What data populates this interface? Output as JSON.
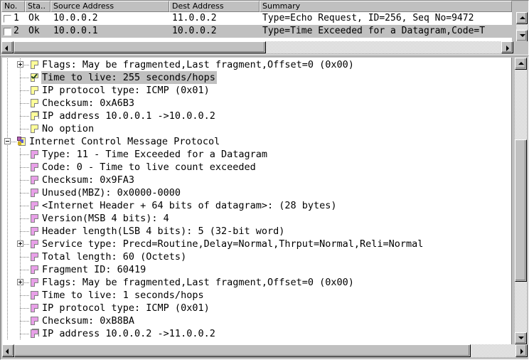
{
  "packet_list": {
    "columns": [
      "No.",
      "Sta..",
      "Source Address",
      "Dest Address",
      "Summary"
    ],
    "rows": [
      {
        "no": "1",
        "status": "Ok",
        "source": "10.0.0.2",
        "dest": "11.0.0.2",
        "summary": "Type=Echo Request, ID=256, Seq No=9472",
        "selected": false,
        "checked": false
      },
      {
        "no": "2",
        "status": "Ok",
        "source": "10.0.0.1",
        "dest": "10.0.0.2",
        "summary": "Type=Time Exceeded for a Datagram,Code=T",
        "selected": true,
        "checked": false
      }
    ]
  },
  "detail_tree": {
    "nodes": [
      {
        "label": "Flags: May be fragmented,Last fragment,Offset=0 (0x00)",
        "depth": 1,
        "icon": "page-yellow",
        "expander": "plus",
        "highlight": false
      },
      {
        "label": "Time to live: 255 seconds/hops",
        "depth": 1,
        "icon": "page-yellow-check",
        "expander": "none",
        "highlight": true
      },
      {
        "label": "IP protocol type: ICMP (0x01)",
        "depth": 1,
        "icon": "page-yellow",
        "expander": "none",
        "highlight": false
      },
      {
        "label": "Checksum: 0xA6B3",
        "depth": 1,
        "icon": "page-yellow",
        "expander": "none",
        "highlight": false
      },
      {
        "label": "IP address 10.0.0.1 ->10.0.0.2",
        "depth": 1,
        "icon": "page-yellow-stack",
        "expander": "none",
        "highlight": false
      },
      {
        "label": "No option",
        "depth": 1,
        "icon": "page-yellow",
        "expander": "none",
        "highlight": false
      },
      {
        "label": "Internet Control Message Protocol",
        "depth": 0,
        "icon": "protocol-root",
        "expander": "minus",
        "highlight": false
      },
      {
        "label": "Type: 11 - Time Exceeded for a Datagram",
        "depth": 1,
        "icon": "page-pink",
        "expander": "none",
        "highlight": false
      },
      {
        "label": "Code: 0 - Time to live count exceeded",
        "depth": 1,
        "icon": "page-pink",
        "expander": "none",
        "highlight": false
      },
      {
        "label": "Checksum: 0x9FA3",
        "depth": 1,
        "icon": "page-pink",
        "expander": "none",
        "highlight": false
      },
      {
        "label": "Unused(MBZ): 0x0000-0000",
        "depth": 1,
        "icon": "page-pink",
        "expander": "none",
        "highlight": false
      },
      {
        "label": "<Internet Header + 64 bits of datagram>: (28 bytes)",
        "depth": 1,
        "icon": "page-pink",
        "expander": "none",
        "highlight": false
      },
      {
        "label": "Version(MSB 4 bits): 4",
        "depth": 1,
        "icon": "page-pink",
        "expander": "none",
        "highlight": false
      },
      {
        "label": "Header length(LSB 4 bits): 5 (32-bit word)",
        "depth": 1,
        "icon": "page-pink",
        "expander": "none",
        "highlight": false
      },
      {
        "label": "Service type: Precd=Routine,Delay=Normal,Thrput=Normal,Reli=Normal",
        "depth": 1,
        "icon": "page-pink",
        "expander": "plus",
        "highlight": false
      },
      {
        "label": "Total length: 60 (Octets)",
        "depth": 1,
        "icon": "page-pink",
        "expander": "none",
        "highlight": false
      },
      {
        "label": "Fragment ID: 60419",
        "depth": 1,
        "icon": "page-pink",
        "expander": "none",
        "highlight": false
      },
      {
        "label": "Flags: May be fragmented,Last fragment,Offset=0 (0x00)",
        "depth": 1,
        "icon": "page-pink",
        "expander": "plus",
        "highlight": false
      },
      {
        "label": "Time to live: 1 seconds/hops",
        "depth": 1,
        "icon": "page-pink",
        "expander": "none",
        "highlight": false
      },
      {
        "label": "IP protocol type: ICMP (0x01)",
        "depth": 1,
        "icon": "page-pink",
        "expander": "none",
        "highlight": false
      },
      {
        "label": "Checksum: 0xB8BA",
        "depth": 1,
        "icon": "page-pink",
        "expander": "none",
        "highlight": false
      },
      {
        "label": "IP address 10.0.0.2 ->11.0.0.2",
        "depth": 1,
        "icon": "page-pink-stack",
        "expander": "none",
        "highlight": false
      }
    ]
  },
  "colors": {
    "face": "#c0c0c0",
    "window": "#ffffff",
    "shadow": "#808080",
    "highlight": "#c0c0c0",
    "icon_yellow": "#ffff99",
    "icon_pink": "#e8a0e8"
  }
}
